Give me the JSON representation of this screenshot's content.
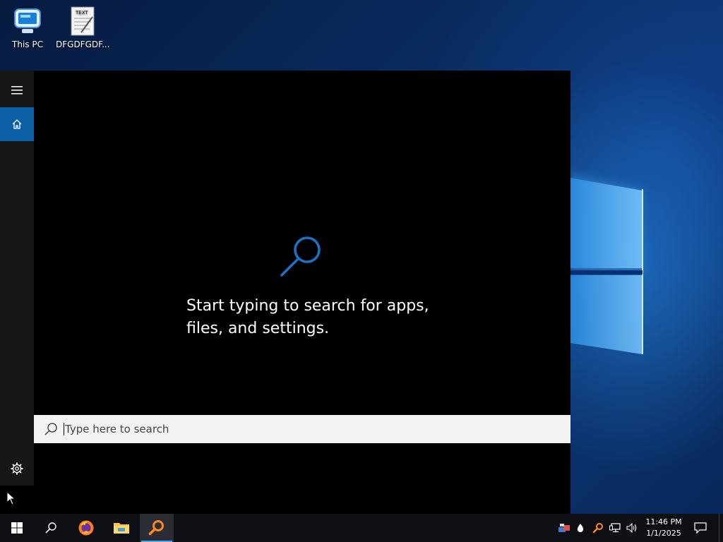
{
  "desktop": {
    "icons": [
      {
        "label": "This PC",
        "icon": "computer-icon"
      },
      {
        "label": "DFGDFGDF...",
        "icon": "text-file-icon",
        "badge": "TEXT"
      }
    ]
  },
  "start_menu": {
    "rail": {
      "menu_icon": "hamburger-icon",
      "home_icon": "home-icon",
      "settings_icon": "gear-icon"
    },
    "search_hint": {
      "icon": "search-icon",
      "text": "Start typing to search for apps, files, and settings."
    },
    "search_box": {
      "placeholder": "Type here to search",
      "value": ""
    }
  },
  "taskbar": {
    "buttons": [
      {
        "name": "start",
        "icon": "windows-logo-icon"
      },
      {
        "name": "search",
        "icon": "search-icon"
      },
      {
        "name": "firefox",
        "icon": "firefox-icon"
      },
      {
        "name": "file-explorer",
        "icon": "folder-icon"
      },
      {
        "name": "search-app",
        "icon": "orange-search-icon",
        "active": true
      }
    ],
    "tray": [
      "network-people-icon",
      "water-drop-icon",
      "orange-search-icon",
      "network-icon",
      "volume-icon"
    ],
    "clock": {
      "time": "11:46 PM",
      "date": "1/1/2025"
    },
    "notification_icon": "notification-icon"
  },
  "colors": {
    "accent": "#0b5fa5",
    "search_icon_blue": "#1a73c8",
    "taskbar": "#0d0f14",
    "start_panel": "#000000"
  }
}
